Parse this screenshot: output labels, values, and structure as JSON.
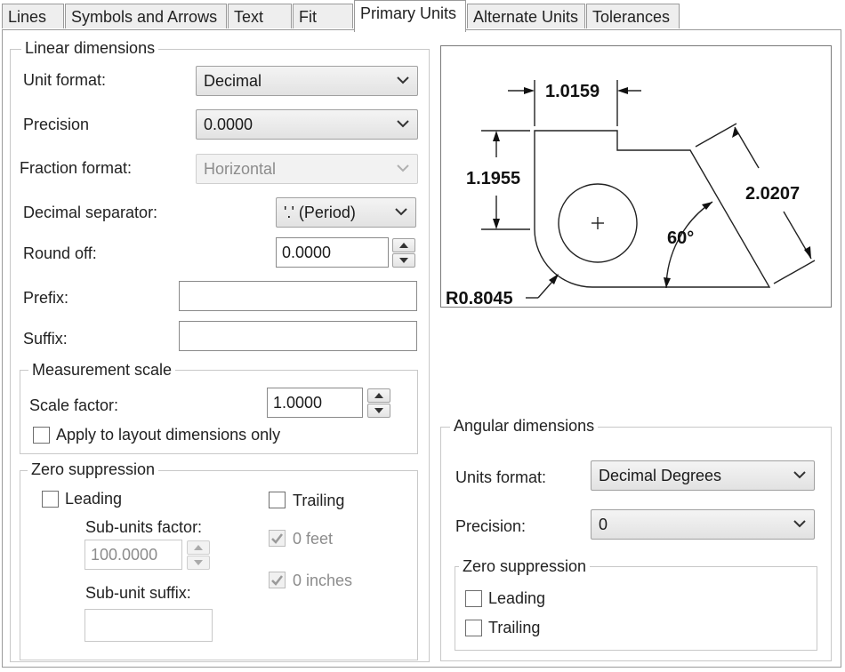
{
  "tabs": [
    "Lines",
    "Symbols and Arrows",
    "Text",
    "Fit",
    "Primary Units",
    "Alternate Units",
    "Tolerances"
  ],
  "active_tab": "Primary Units",
  "linear": {
    "legend": "Linear dimensions",
    "unit_format_label": "Unit format:",
    "unit_format_value": "Decimal",
    "precision_label": "Precision",
    "precision_value": "0.0000",
    "fraction_format_label": "Fraction format:",
    "fraction_format_value": "Horizontal",
    "decimal_separator_label": "Decimal separator:",
    "decimal_separator_value": "'.' (Period)",
    "round_off_label": "Round off:",
    "round_off_value": "0.0000",
    "prefix_label": "Prefix:",
    "prefix_value": "",
    "suffix_label": "Suffix:",
    "suffix_value": ""
  },
  "measurement_scale": {
    "legend": "Measurement scale",
    "scale_factor_label": "Scale factor:",
    "scale_factor_value": "1.0000",
    "apply_layout_label": "Apply to layout dimensions only",
    "apply_layout_checked": false
  },
  "zero_suppression_linear": {
    "legend": "Zero suppression",
    "leading_label": "Leading",
    "leading_checked": false,
    "trailing_label": "Trailing",
    "trailing_checked": false,
    "sub_units_factor_label": "Sub-units factor:",
    "sub_units_factor_value": "100.0000",
    "zero_feet_label": "0 feet",
    "zero_feet_checked": true,
    "zero_inches_label": "0 inches",
    "zero_inches_checked": true,
    "sub_unit_suffix_label": "Sub-unit suffix:",
    "sub_unit_suffix_value": ""
  },
  "preview": {
    "dim_top": "1.0159",
    "dim_left": "1.1955",
    "dim_diagonal": "2.0207",
    "dim_angle": "60°",
    "dim_radius": "R0.8045"
  },
  "angular": {
    "legend": "Angular dimensions",
    "units_format_label": "Units format:",
    "units_format_value": "Decimal Degrees",
    "precision_label": "Precision:",
    "precision_value": "0"
  },
  "zero_suppression_angular": {
    "legend": "Zero suppression",
    "leading_label": "Leading",
    "leading_checked": false,
    "trailing_label": "Trailing",
    "trailing_checked": false
  },
  "icons": [
    "chevron-down-icon",
    "spin-up-icon",
    "spin-down-icon",
    "checkmark-icon"
  ]
}
